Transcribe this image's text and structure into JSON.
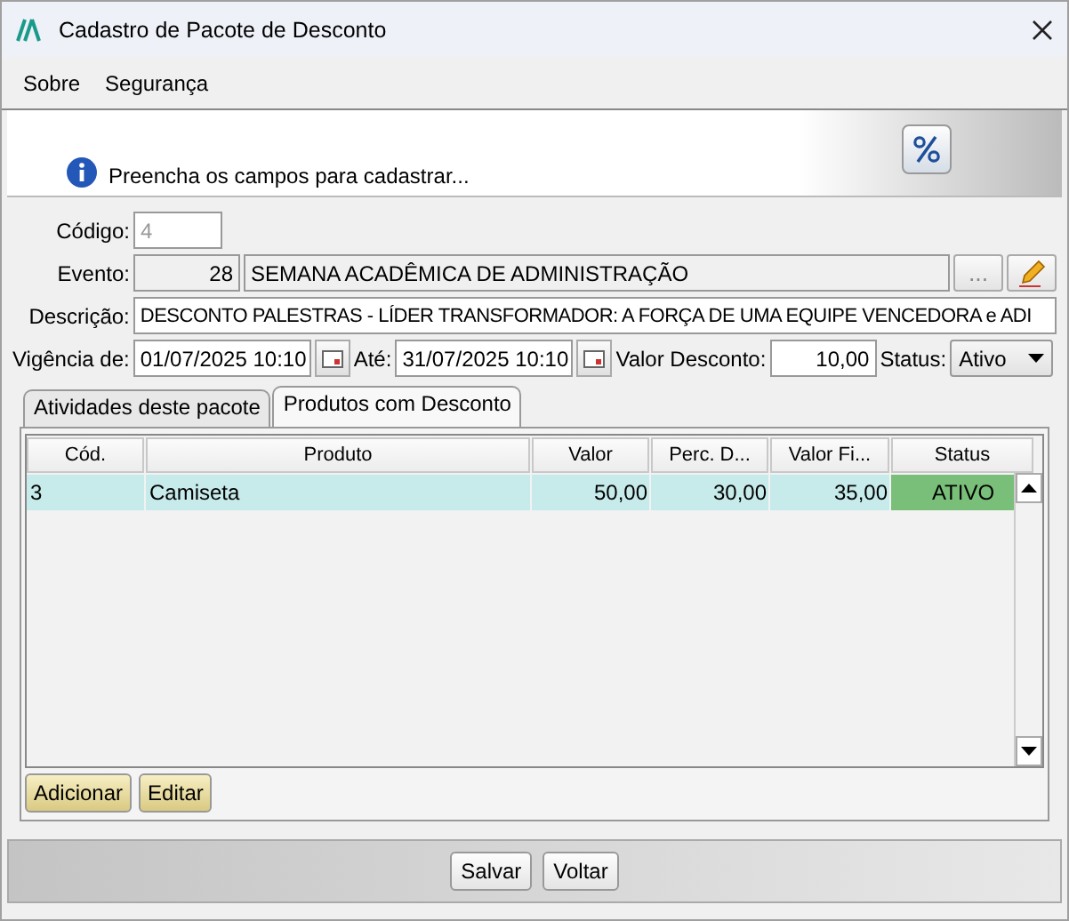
{
  "window": {
    "title": "Cadastro de Pacote de Desconto"
  },
  "menu": [
    {
      "label": "Sobre"
    },
    {
      "label": "Segurança"
    }
  ],
  "banner": {
    "message": "Preencha os campos para cadastrar..."
  },
  "form": {
    "codigo": {
      "label": "Código:",
      "value": "4",
      "disabled": true
    },
    "evento": {
      "label": "Evento:",
      "code": "28",
      "name": "SEMANA ACADÊMICA DE ADMINISTRAÇÃO",
      "lookup": "..."
    },
    "descricao": {
      "label": "Descrição:",
      "value": "DESCONTO PALESTRAS - LÍDER TRANSFORMADOR: A FORÇA DE UMA EQUIPE VENCEDORA e ADI"
    },
    "vigencia": {
      "label": "Vigência de:",
      "value": "01/07/2025 10:10"
    },
    "ate": {
      "label": "Até:",
      "value": "31/07/2025 10:10"
    },
    "valor_desconto": {
      "label": "Valor Desconto:",
      "value": "10,00"
    },
    "status": {
      "label": "Status:",
      "value": "Ativo"
    }
  },
  "tabs": [
    {
      "label": "Atividades deste pacote",
      "selected": false
    },
    {
      "label": "Produtos com Desconto",
      "selected": true
    }
  ],
  "table": {
    "columns": [
      {
        "label": "Cód."
      },
      {
        "label": "Produto"
      },
      {
        "label": "Valor"
      },
      {
        "label": "Perc. D..."
      },
      {
        "label": "Valor Fi..."
      },
      {
        "label": "Status"
      }
    ],
    "rows": [
      {
        "selected": true,
        "cells": [
          "3",
          "Camiseta",
          "50,00",
          "30,00",
          "35,00"
        ],
        "status": {
          "text": "ATIVO",
          "color": "#79bf79"
        }
      }
    ]
  },
  "table_buttons": [
    {
      "label": "Adicionar"
    },
    {
      "label": "Editar"
    }
  ],
  "footer_buttons": [
    {
      "label": "Salvar"
    },
    {
      "label": "Voltar"
    }
  ]
}
